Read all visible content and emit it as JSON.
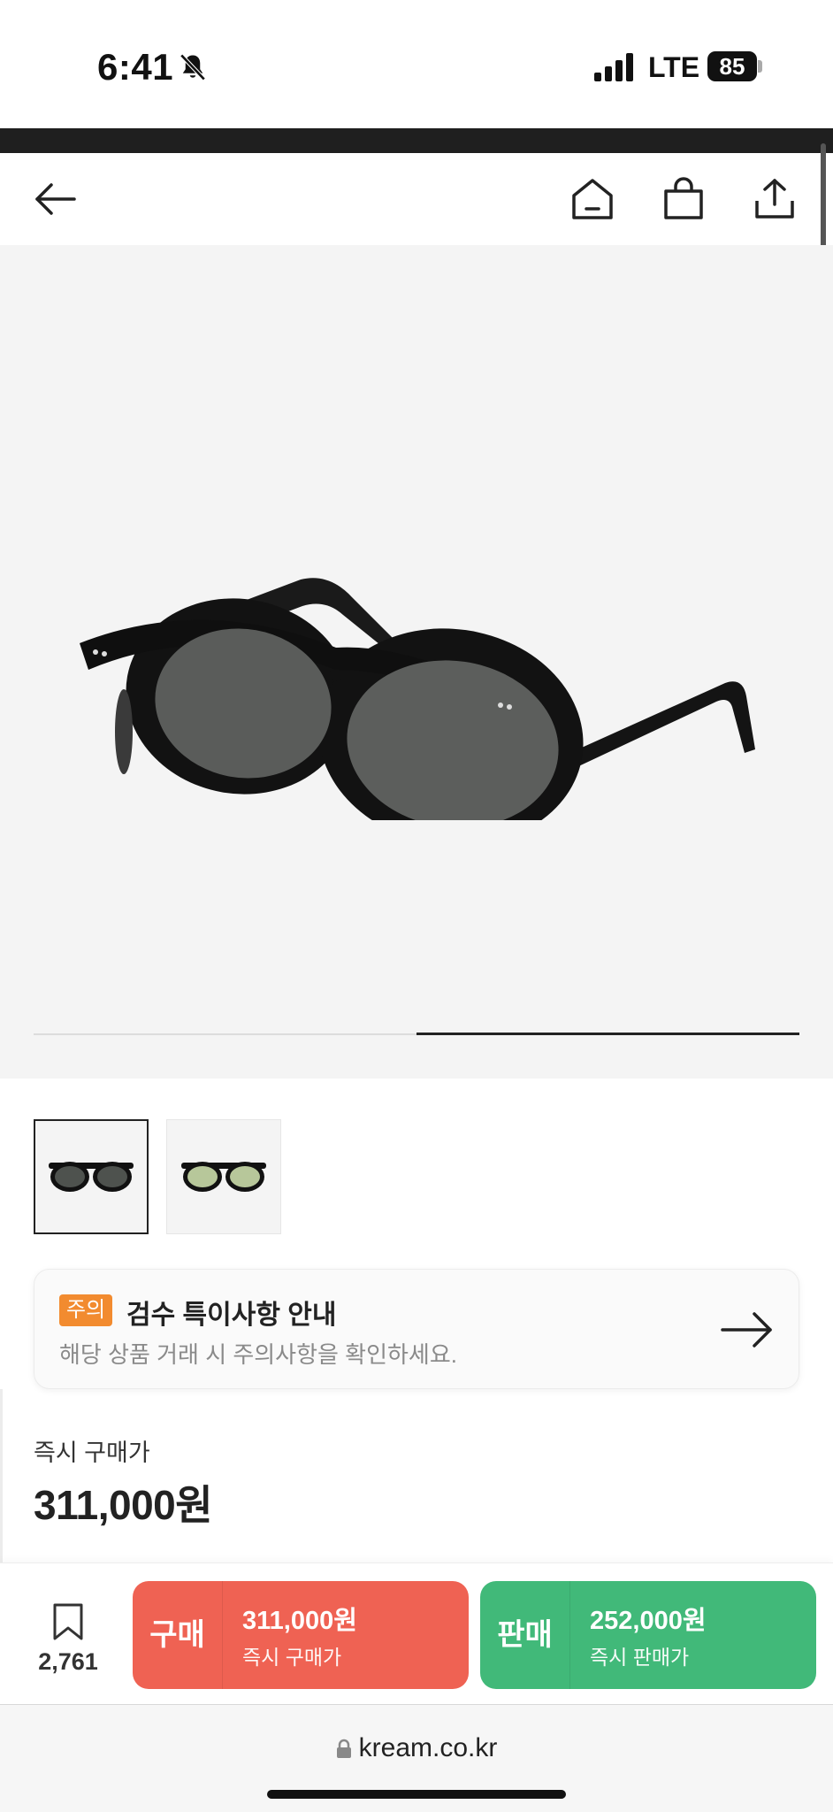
{
  "status_bar": {
    "time": "6:41",
    "network": "LTE",
    "battery": "85",
    "icons": [
      "bell-slash-icon",
      "signal-icon"
    ]
  },
  "nav": {
    "icons": [
      "back-arrow-icon",
      "home-icon",
      "shopping-bag-icon",
      "share-icon"
    ]
  },
  "hero": {
    "image": "black-sunglasses-product-photo",
    "slide_progress": 0.5
  },
  "thumbnails": [
    {
      "label": "black-dark-lens-sunglasses",
      "selected": true
    },
    {
      "label": "black-green-lens-sunglasses",
      "selected": false
    }
  ],
  "notice": {
    "badge": "주의",
    "title": "검수 특이사항 안내",
    "subtitle": "해당 상품 거래 시 주의사항을 확인하세요."
  },
  "price": {
    "label": "즉시 구매가",
    "value": "311,000원"
  },
  "action_bar": {
    "wish_count": "2,761",
    "buy": {
      "label": "구매",
      "price": "311,000원",
      "sub": "즉시 구매가"
    },
    "sell": {
      "label": "판매",
      "price": "252,000원",
      "sub": "즉시 판매가"
    }
  },
  "browser": {
    "url": "kream.co.kr"
  },
  "colors": {
    "buy": "#ef6253",
    "sell": "#41b979",
    "badge": "#f28b2f",
    "hero_bg": "#f4f4f4"
  }
}
